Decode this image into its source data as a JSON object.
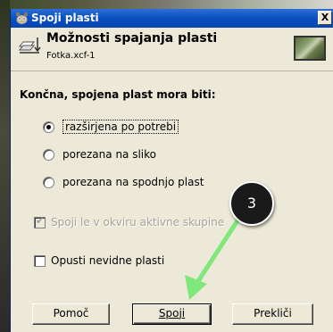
{
  "window": {
    "title": "Spoji plasti",
    "close_glyph": "X"
  },
  "header": {
    "title": "Možnosti spajanja plasti",
    "subtitle": "Fotka.xcf-1"
  },
  "section": {
    "label": "Končna, spojena plast mora biti:"
  },
  "options": [
    {
      "label": "razširjena po potrebi",
      "checked": true
    },
    {
      "label": "porezana na sliko",
      "checked": false
    },
    {
      "label": "porezana na spodnjo plast",
      "checked": false
    }
  ],
  "checkboxes": {
    "active_group": {
      "label": "Spoji le v okviru aktivne skupine",
      "checked": true,
      "disabled": true
    },
    "discard_invisible": {
      "label": "Opusti nevidne plasti",
      "checked": false,
      "disabled": false
    }
  },
  "buttons": {
    "help": "Pomoč",
    "merge": "Spoji",
    "cancel": "Prekliči"
  },
  "annotation": {
    "number": "3",
    "arrow_color": "#7ee87a"
  },
  "colors": {
    "titlebar": "#0a4fc0",
    "dialog_bg": "#ece9d8"
  }
}
